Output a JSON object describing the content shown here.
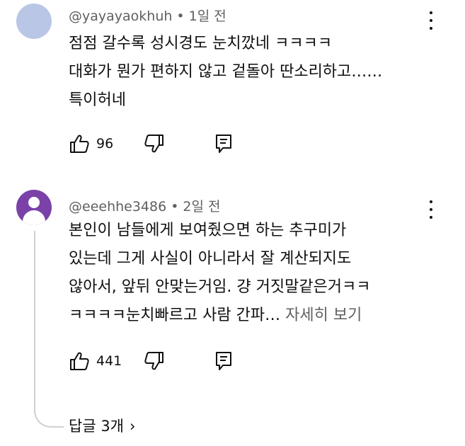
{
  "comments": [
    {
      "author": "@yayayaokhuh",
      "separator": "•",
      "time": "1일 전",
      "lines": [
        "점점 갈수록 성시경도 눈치깠네 ㅋㅋㅋㅋ",
        "대화가 뭔가 편하지 않고 겉돌아 딴소리하고……",
        "특이허네"
      ],
      "likes": "96",
      "icons": {
        "like": "thumbs-up-icon",
        "dislike": "thumbs-down-icon",
        "reply": "reply-icon",
        "more": "more-vert-icon"
      }
    },
    {
      "author": "@eeehhe3486",
      "separator": "•",
      "time": "2일 전",
      "lines": [
        "본인이 남들에게 보여줬으면 하는 추구미가",
        "있는데 그게 사실이 아니라서 잘 계산되지도",
        "않아서, 앞뒤 안맞는거임. 걍 거짓말같은거ㅋㅋ",
        "ㅋㅋㅋㅋ눈치빠르고 사람 간파…"
      ],
      "read_more": "자세히 보기",
      "likes": "441",
      "icons": {
        "like": "thumbs-up-icon",
        "dislike": "thumbs-down-icon",
        "reply": "reply-icon",
        "more": "more-vert-icon"
      }
    }
  ],
  "replies_label": "답글 3개",
  "replies_chevron": "›",
  "colors": {
    "text": "#0f0f0f",
    "secondary": "#606060",
    "avatar1": "#b9c6e6",
    "avatar2": "#7a42a8",
    "thread_line": "#d0d0d0"
  }
}
